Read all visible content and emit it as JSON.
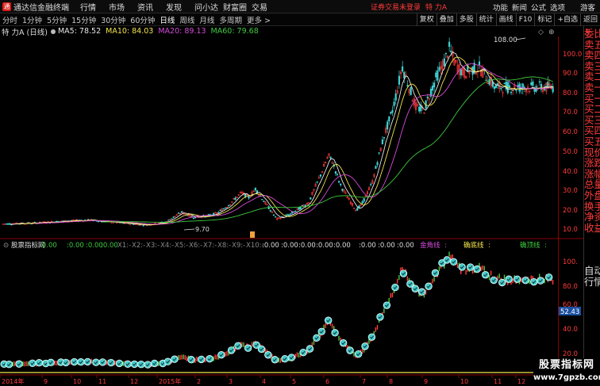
{
  "titlebar": {
    "logo_char": "通",
    "app_title": "通达信金融终端",
    "menu": [
      "行情",
      "市场",
      "资讯",
      "发现",
      "问小达",
      "财富圈",
      "交易"
    ],
    "login_status": "证券交易未登录",
    "stock": "特 力A",
    "buttons": [
      "功能",
      "新闻",
      "公式",
      "选项"
    ],
    "guest": "游客"
  },
  "toolbar": {
    "periods": [
      "分时",
      "1分钟",
      "5分钟",
      "15分钟",
      "30分钟",
      "60分钟",
      "日线",
      "周线",
      "月线",
      "多周期",
      "更多 >"
    ],
    "active_period": "日线",
    "tools": [
      "复权",
      "叠加",
      "多股",
      "统计",
      "画线",
      "F10",
      "标记",
      "+自选",
      "返回"
    ]
  },
  "info": {
    "stock_name": "特 力A (日线)",
    "ma": [
      {
        "label": "MA5: 78.52",
        "color": "#e8e8e8"
      },
      {
        "label": "MA10: 84.03",
        "color": "#f2e34c"
      },
      {
        "label": "MA20: 89.13",
        "color": "#d54bd9"
      },
      {
        "label": "MA60: 79.68",
        "color": "#3fca3f"
      }
    ]
  },
  "chart_data": {
    "type": "candlestick",
    "price_axis_ticks": [
      "100.0",
      "90.0",
      "80.0",
      "70.0",
      "60.0",
      "50.0",
      "40.0",
      "30.0",
      "20.0",
      "10.0"
    ],
    "high_label": "108.00",
    "low_label": "9.70",
    "indicator": {
      "name": "股票指标网",
      "params": [
        ":0.00",
        ":0.00",
        ":0.00",
        ":0.00",
        "X1:-",
        "X2:-",
        "X3:-",
        "X4:-",
        "X5:-",
        "X6:-",
        "X7:-",
        "X8:-",
        "X9:-",
        "X10:-",
        ":0.00",
        ":0.00",
        ":0.00",
        ":0.00",
        ":0.00",
        ":0.00",
        ":0.00",
        ":0.00"
      ],
      "line_labels": [
        "金角线",
        "确底线",
        "确顶线"
      ],
      "line_values": [
        ":",
        ":",
        ":"
      ],
      "axis_ticks": [
        "100.",
        "80.0",
        "60.0",
        "40.0",
        "20.0"
      ],
      "current_value": "52.43"
    },
    "x_labels": [
      "2014年",
      "9",
      "10",
      "11",
      "12",
      "2015年",
      "2",
      "3",
      "4",
      "5",
      "6",
      "7",
      "8",
      "9",
      "10",
      "11",
      "12"
    ]
  },
  "sidebar": {
    "badge": "L",
    "items": [
      "委比",
      "卖五",
      "卖四",
      "卖三",
      "卖二",
      "卖一",
      "买一",
      "买二",
      "买三",
      "买四",
      "买五",
      "现价",
      "涨跌",
      "涨幅",
      "总量",
      "外盘",
      "换手",
      "净资",
      "收益"
    ],
    "bottom_items": [
      "自动",
      "行情"
    ]
  },
  "watermark": {
    "title": "股票指标网",
    "url": "www.7gpzb.com"
  },
  "colors": {
    "up": "#ff3b3b",
    "down": "#3fd6d6",
    "ma5": "#e8e8e8",
    "ma10": "#f2e34c",
    "ma20": "#d54bd9",
    "ma60": "#3fca3f",
    "axis": "#8b0000"
  }
}
